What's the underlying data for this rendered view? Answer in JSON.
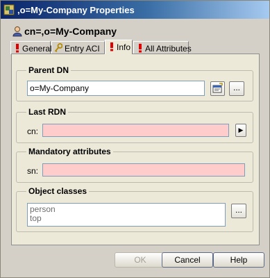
{
  "window": {
    "title": ",o=My-Company Properties"
  },
  "header": {
    "title": "cn=,o=My-Company"
  },
  "tabs": [
    {
      "label": "General",
      "icon": "exclamation-icon"
    },
    {
      "label": "Entry ACI",
      "icon": "key-icon"
    },
    {
      "label": "Info",
      "icon": "exclamation-icon",
      "active": true
    },
    {
      "label": "All Attributes",
      "icon": "exclamation-icon"
    }
  ],
  "parent_dn": {
    "title": "Parent DN",
    "value": "o=My-Company",
    "browse_label": "..."
  },
  "last_rdn": {
    "title": "Last RDN",
    "label": "cn:",
    "value": "",
    "arrow": "▶"
  },
  "mandatory": {
    "title": "Mandatory attributes",
    "label": "sn:",
    "value": ""
  },
  "object_classes": {
    "title": "Object classes",
    "items": [
      "person",
      "top"
    ],
    "browse_label": "..."
  },
  "buttons": {
    "ok": "OK",
    "cancel": "Cancel",
    "help": "Help"
  },
  "colors": {
    "invalid_field": "#FFCCCC",
    "titlebar": "#0A246A",
    "error_icon": "#FF0000"
  }
}
